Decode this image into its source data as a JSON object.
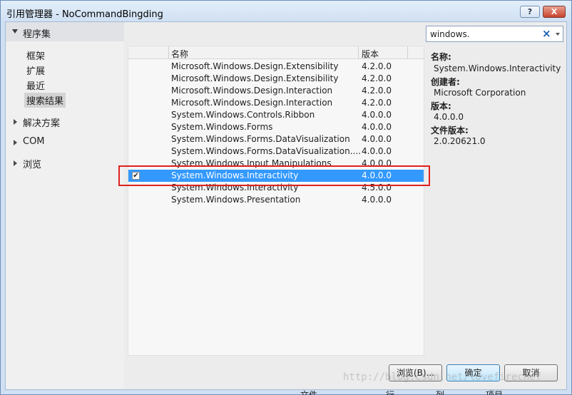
{
  "window": {
    "title": "引用管理器 - NoCommandBingding"
  },
  "titlebar": {
    "help_label": "?",
    "close_label": "X"
  },
  "sidebar": {
    "group_label": "程序集",
    "sub_items": [
      "框架",
      "扩展",
      "最近",
      "搜索结果"
    ],
    "selected_sub_item": "搜索结果",
    "categories": [
      "解决方案",
      "COM",
      "浏览"
    ]
  },
  "search": {
    "value": "windows.",
    "clear_icon": "×"
  },
  "list": {
    "columns": {
      "name": "名称",
      "version": "版本"
    },
    "rows": [
      {
        "name": "Microsoft.Windows.Design.Extensibility",
        "version": "4.2.0.0"
      },
      {
        "name": "Microsoft.Windows.Design.Extensibility",
        "version": "4.2.0.0"
      },
      {
        "name": "Microsoft.Windows.Design.Interaction",
        "version": "4.2.0.0"
      },
      {
        "name": "Microsoft.Windows.Design.Interaction",
        "version": "4.2.0.0"
      },
      {
        "name": "System.Windows.Controls.Ribbon",
        "version": "4.0.0.0"
      },
      {
        "name": "System.Windows.Forms",
        "version": "4.0.0.0"
      },
      {
        "name": "System.Windows.Forms.DataVisualization",
        "version": "4.0.0.0"
      },
      {
        "name": "System.Windows.Forms.DataVisualization....",
        "version": "4.0.0.0"
      },
      {
        "name": "System.Windows.Input.Manipulations",
        "version": "4.0.0.0"
      },
      {
        "name": "System.Windows.Interactivity",
        "version": "4.0.0.0",
        "selected": true,
        "checked": true,
        "check_glyph": "✔"
      },
      {
        "name": "System.Windows.Interactivity",
        "version": "4.5.0.0"
      },
      {
        "name": "System.Windows.Presentation",
        "version": "4.0.0.0"
      }
    ]
  },
  "details": {
    "name_label": "名称:",
    "name_value": "System.Windows.Interactivity",
    "creator_label": "创建者:",
    "creator_value": "Microsoft Corporation",
    "version_label": "版本:",
    "version_value": "4.0.0.0",
    "file_version_label": "文件版本:",
    "file_version_value": "2.0.20621.0"
  },
  "buttons": {
    "browse": "浏览(B)...",
    "ok": "确定",
    "cancel": "取消"
  },
  "watermark": "http://blog.csdn.net/lovefirechef",
  "background_strip": [
    "文件",
    "行",
    "列",
    "项目"
  ],
  "colors": {
    "selection": "#3399ff",
    "highlight_box": "#e0221f",
    "frame": "#cfe0f3"
  }
}
